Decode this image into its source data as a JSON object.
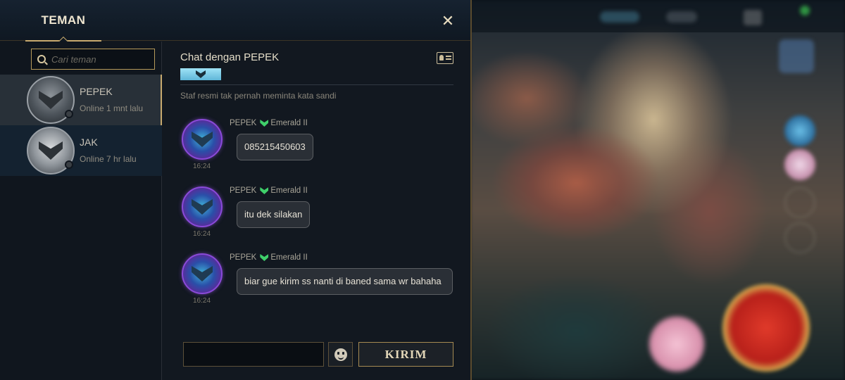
{
  "header": {
    "tab_label": "TEMAN",
    "close_symbol": "✕"
  },
  "search": {
    "placeholder": "Cari teman",
    "icon": "search-icon"
  },
  "friends": [
    {
      "name": "PEPEK",
      "status": "Online 1 mnt lalu",
      "selected": true
    },
    {
      "name": "JAK",
      "status": "Online 7 hr lalu",
      "selected": false
    }
  ],
  "chat": {
    "title": "Chat dengan PEPEK",
    "staff_note": "Staf resmi tak pernah meminta kata sandi",
    "messages": [
      {
        "sender": "PEPEK",
        "rank": "Emerald II",
        "time": "16:24",
        "text": "085215450603"
      },
      {
        "sender": "PEPEK",
        "rank": "Emerald II",
        "time": "16:24",
        "text": "itu dek silakan"
      },
      {
        "sender": "PEPEK",
        "rank": "Emerald II",
        "time": "16:24",
        "text": "biar gue kirim ss nanti di baned sama wr bahaha"
      }
    ],
    "input_value": "",
    "send_label": "KIRIM"
  },
  "colors": {
    "accent_gold": "#c8aa6e",
    "rank_emerald": "#3fcf6a",
    "rank_banner": "#5fb6d8"
  }
}
